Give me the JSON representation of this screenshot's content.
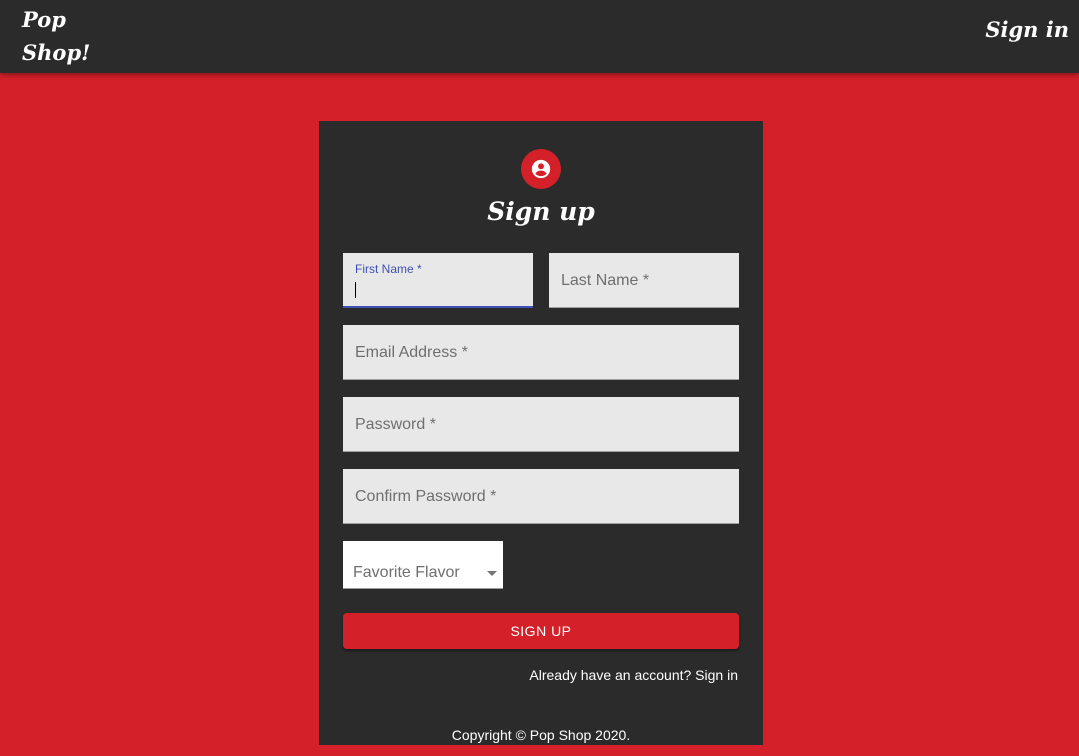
{
  "header": {
    "brand_line1": "Pop",
    "brand_line2": "Shop!",
    "signin_link": "Sign in"
  },
  "form": {
    "icon": "account-circle-icon",
    "title": "Sign up",
    "fields": {
      "first_name": {
        "label": "First Name *",
        "value": ""
      },
      "last_name": {
        "placeholder": "Last Name *"
      },
      "email": {
        "placeholder": "Email Address *"
      },
      "password": {
        "placeholder": "Password *"
      },
      "confirm_password": {
        "placeholder": "Confirm Password *"
      }
    },
    "flavor_select": {
      "value": "Favorite Flavor"
    },
    "submit_label": "SIGN UP",
    "signin_prompt": "Already have an account? Sign in"
  },
  "footer": {
    "copyright": "Copyright © Pop Shop 2020."
  },
  "colors": {
    "accent": "#d32029",
    "surface": "#2b2b2b",
    "field_bg": "#e8e8e8",
    "focus": "#3f51b5"
  }
}
